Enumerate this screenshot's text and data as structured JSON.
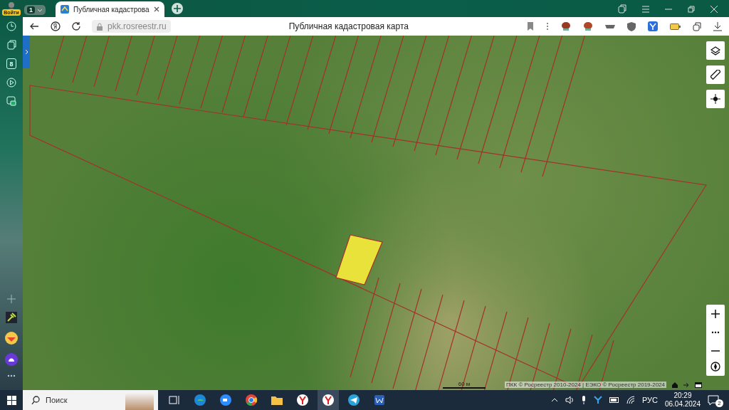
{
  "browser": {
    "profile_label": "Войти",
    "tab_count": "1",
    "tabs": [
      {
        "title": "Публичная кадастрова",
        "selected": true
      }
    ],
    "url": "pkk.rosreestr.ru",
    "page_title": "Публичная кадастровая карта"
  },
  "sidebar": {
    "badge": "8"
  },
  "map": {
    "scale_label": "60 м",
    "attribution": "ПКК © Росреестр 2010-2024 | ЕЭКО © Росреестр 2019-2024"
  },
  "taskbar": {
    "search_placeholder": "Поиск",
    "language": "РУС",
    "time": "20:29",
    "date": "06.04.2024",
    "notification_count": "2"
  }
}
